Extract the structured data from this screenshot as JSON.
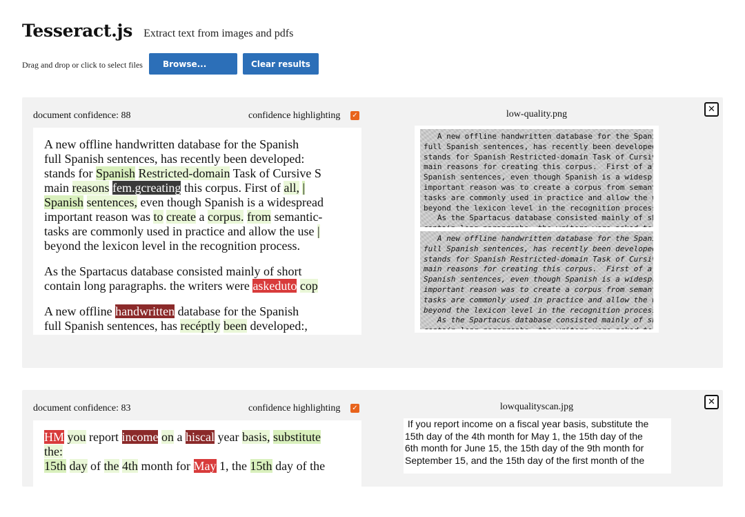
{
  "header": {
    "title": "Tesseract.js",
    "tagline": "Extract text from images and pdfs"
  },
  "controls": {
    "hint": "Drag and drop or click to select files",
    "browse_label": "Browse...",
    "clear_label": "Clear results"
  },
  "colors": {
    "button": "#2c6fb8",
    "checkbox": "#e8631c",
    "high_confidence": "#eaf7d8",
    "medium_confidence": "#d9f0bd",
    "low_confidence": "#d83b3b",
    "very_low_confidence": "#8b2a2a",
    "unrecognized": "#3a3a3a"
  },
  "results": [
    {
      "confidence_text": "document confidence: 88",
      "highlight_label": "confidence highlighting",
      "highlight_checked": true,
      "filename": "low-quality.png",
      "close_icon": "close-icon",
      "paragraphs": [
        [
          [
            [
              "A",
              "n"
            ],
            [
              "new",
              "n"
            ],
            [
              "offline",
              "n"
            ],
            [
              "handwritten",
              "n"
            ],
            [
              "database",
              "n"
            ],
            [
              "for",
              "n"
            ],
            [
              "the",
              "n"
            ],
            [
              "Spanish",
              "n"
            ]
          ],
          [
            [
              "full",
              "n"
            ],
            [
              "Spanish",
              "n"
            ],
            [
              "sentences,",
              "n"
            ],
            [
              "has",
              "n"
            ],
            [
              "recently",
              "n"
            ],
            [
              "been",
              "n"
            ],
            [
              "developed:",
              "n"
            ]
          ],
          [
            [
              "stands",
              "n"
            ],
            [
              "for",
              "n"
            ],
            [
              "Spanish",
              "m"
            ],
            [
              "Restricted-domain",
              "h"
            ],
            [
              "Task",
              "n"
            ],
            [
              "of",
              "n"
            ],
            [
              "Cursive",
              "n"
            ],
            [
              "S",
              "n"
            ]
          ],
          [
            [
              "main",
              "n"
            ],
            [
              "reasons",
              "h"
            ],
            [
              "fem.gcreating",
              "d"
            ],
            [
              "this",
              "n"
            ],
            [
              "corpus.",
              "n"
            ],
            [
              "First",
              "n"
            ],
            [
              "of",
              "n"
            ],
            [
              "all,",
              "h"
            ],
            [
              "|",
              "m"
            ]
          ],
          [
            [
              "Spanish",
              "m"
            ],
            [
              "sentences,",
              "h"
            ],
            [
              "even",
              "n"
            ],
            [
              "though",
              "n"
            ],
            [
              "Spanish",
              "n"
            ],
            [
              "is",
              "n"
            ],
            [
              "a",
              "n"
            ],
            [
              "widespread",
              "n"
            ]
          ],
          [
            [
              "important",
              "n"
            ],
            [
              "reason",
              "n"
            ],
            [
              "was",
              "n"
            ],
            [
              "to",
              "h"
            ],
            [
              "create",
              "h"
            ],
            [
              "a",
              "n"
            ],
            [
              "corpus.",
              "h"
            ],
            [
              "from",
              "h"
            ],
            [
              "semantic-",
              "n"
            ]
          ],
          [
            [
              "tasks",
              "n"
            ],
            [
              "are",
              "n"
            ],
            [
              "commonly",
              "n"
            ],
            [
              "used",
              "n"
            ],
            [
              "in",
              "n"
            ],
            [
              "practice",
              "n"
            ],
            [
              "and",
              "n"
            ],
            [
              "allow",
              "n"
            ],
            [
              "the",
              "n"
            ],
            [
              "use",
              "n"
            ],
            [
              "|",
              "h"
            ]
          ],
          [
            [
              "beyond",
              "n"
            ],
            [
              "the",
              "n"
            ],
            [
              "lexicon",
              "n"
            ],
            [
              "level",
              "n"
            ],
            [
              "in",
              "n"
            ],
            [
              "the",
              "n"
            ],
            [
              "recognition",
              "n"
            ],
            [
              "process.",
              "n"
            ]
          ]
        ],
        [
          [
            [
              "As",
              "n"
            ],
            [
              "the",
              "n"
            ],
            [
              "Spartacus",
              "n"
            ],
            [
              "database",
              "n"
            ],
            [
              "consisted",
              "n"
            ],
            [
              "mainly",
              "n"
            ],
            [
              "of",
              "n"
            ],
            [
              "short",
              "n"
            ]
          ],
          [
            [
              "contain",
              "n"
            ],
            [
              "long",
              "n"
            ],
            [
              "paragraphs.",
              "n"
            ],
            [
              "the",
              "n"
            ],
            [
              "writers",
              "n"
            ],
            [
              "were",
              "n"
            ],
            [
              "askeduto",
              "l"
            ],
            [
              "cop",
              "h"
            ]
          ]
        ],
        [
          [
            [
              "A",
              "n"
            ],
            [
              "new",
              "n"
            ],
            [
              "offline",
              "n"
            ],
            [
              "handwritten",
              "b"
            ],
            [
              "database",
              "n"
            ],
            [
              "for",
              "n"
            ],
            [
              "the",
              "n"
            ],
            [
              "Spanish",
              "n"
            ]
          ],
          [
            [
              "full",
              "n"
            ],
            [
              "Spanish",
              "n"
            ],
            [
              "sentences,",
              "n"
            ],
            [
              "has",
              "n"
            ],
            [
              "recéptly",
              "h"
            ],
            [
              "been",
              "h"
            ],
            [
              "developed:,",
              "n"
            ]
          ]
        ]
      ],
      "scan_lines_top": [
        "   A new offline handwritten database for the Spanish",
        "full Spanish sentences, has recently been developed:",
        "stands for Spanish Restricted-domain Task of Cursive S",
        "main reasons for creating this corpus.  First of all,",
        "Spanish sentences, even though Spanish is a widespread",
        "important reason was to create a corpus from semantic-",
        "tasks are commonly used in practice and allow the use",
        "beyond the lexicon level in the recognition process.",
        "   As the Spartacus database consisted mainly of short",
        "contain long paragraphs, the writers were asked to cop"
      ],
      "scan_lines_bottom": [
        "   A new offline handwritten database for the Spanish",
        "full Spanish sentences, has recently been developed:",
        "stands for Spanish Restricted-domain Task of Cursive S",
        "main reasons for creating this corpus.  First of all,",
        "Spanish sentences, even though Spanish is a widespread",
        "important reason was to create a corpus from semantic-",
        "tasks are commonly used in practice and allow the use",
        "beyond the lexicon level in the recognition process.",
        "   As the Spartacus database consisted mainly of short",
        "contain long paragraphs, the writers were asked to cop"
      ]
    },
    {
      "confidence_text": "document confidence: 83",
      "highlight_label": "confidence highlighting",
      "highlight_checked": true,
      "filename": "lowqualityscan.jpg",
      "close_icon": "close-icon",
      "paragraphs": [
        [
          [
            [
              "HM",
              "l"
            ],
            [
              "you",
              "h"
            ],
            [
              "report",
              "n"
            ],
            [
              "income",
              "b"
            ],
            [
              "on",
              "h"
            ],
            [
              "a",
              "n"
            ],
            [
              "hiscal",
              "b"
            ],
            [
              "year",
              "n"
            ],
            [
              "basis,",
              "h"
            ],
            [
              "substitute",
              "m"
            ]
          ],
          [
            [
              "the:",
              "h"
            ]
          ],
          [
            [
              "15th",
              "m"
            ],
            [
              "day",
              "h"
            ],
            [
              "of",
              "n"
            ],
            [
              "the",
              "h"
            ],
            [
              "4th",
              "h"
            ],
            [
              "month",
              "n"
            ],
            [
              "for",
              "n"
            ],
            [
              "May",
              "l"
            ],
            [
              "1,",
              "n"
            ],
            [
              "the",
              "n"
            ],
            [
              "15th",
              "m"
            ],
            [
              "day",
              "n"
            ],
            [
              "of",
              "n"
            ],
            [
              "the",
              "n"
            ]
          ]
        ]
      ],
      "scan_lines": [
        " If you report income on a fiscal year basis, substitute the",
        "15th day of the 4th month for May 1, the 15th day of the",
        "6th month for June 15, the 15th day of the 9th month for",
        "September 15, and the 15th day of the first month of the"
      ]
    }
  ]
}
